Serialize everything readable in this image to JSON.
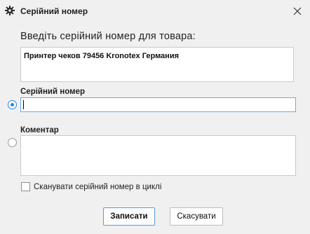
{
  "window": {
    "title": "Серійний номер",
    "title_icon": "gear-icon",
    "close_icon": "close-icon"
  },
  "form": {
    "heading": "Введіть серійний номер для товара:",
    "product_text": "Принтер чеков 79456 Kronotex Германия",
    "serial_label": "Серійний номер",
    "serial_value": "",
    "serial_selected": true,
    "comment_label": "Коментар",
    "comment_value": "",
    "comment_selected": false,
    "scan_loop_label": "Сканувати серійний номер в циклі",
    "scan_loop_checked": false
  },
  "buttons": {
    "save_label": "Записати",
    "cancel_label": "Скасувати"
  },
  "colors": {
    "accent": "#1e88e5",
    "window_bg": "#f0f0f0"
  }
}
